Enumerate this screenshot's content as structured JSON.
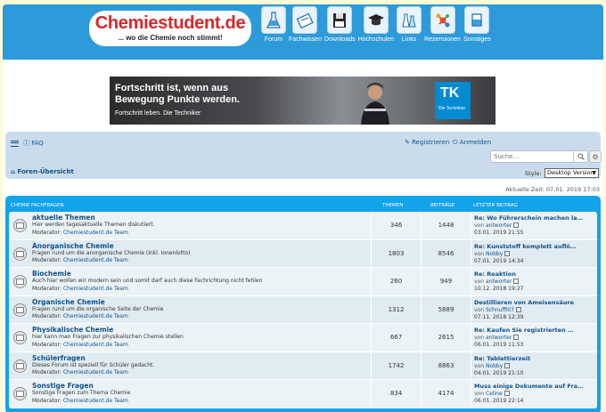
{
  "header": {
    "logo_title": "Chemiestudent.de",
    "logo_subtitle": "... wo die Chemie noch stimmt!",
    "nav": [
      {
        "label": "Forum",
        "icon": "forum-flask-icon"
      },
      {
        "label": "Fachwissen",
        "icon": "fachwissen-book-icon"
      },
      {
        "label": "Downloads",
        "icon": "downloads-disk-icon"
      },
      {
        "label": "Hochschulen",
        "icon": "hochschulen-graduation-cap-icon"
      },
      {
        "label": "Links",
        "icon": "links-bottles-icon"
      },
      {
        "label": "Rezensionen",
        "icon": "rezensionen-molecule-icon"
      },
      {
        "label": "Sonstiges",
        "icon": "sonstiges-beaker-icon"
      }
    ]
  },
  "ad": {
    "headline": "Fortschritt ist, wenn aus Bewegung Punkte werden.",
    "subline": "Fortschritt leben. Die Techniker",
    "brand_logo": "TK",
    "brand_text": "Die Techniker",
    "brand_color": "#008bd2"
  },
  "navbar": {
    "faq": "FAQ",
    "register": "Registrieren",
    "login": "Anmelden",
    "search_placeholder": "Suche…",
    "home": "Foren-Übersicht",
    "style_label": "Style:",
    "style_value": "Desktop Version"
  },
  "current_time": "Aktuelle Zeit: 07.01. 2019 17:03",
  "forum_table": {
    "headers": {
      "category": "Chemie Fachfragen",
      "topics": "Themen",
      "posts": "Beiträge",
      "last_post": "Letzter Beitrag"
    },
    "rows": [
      {
        "title": "aktuelle Themen",
        "desc": "Hier werden tagesaktuelle Themen diskutiert.",
        "mod_label": "Moderator:",
        "mod": "Chemiestudent.de Team",
        "topics": "346",
        "posts": "1448",
        "last_title": "Re: Wo Führerschein machen la…",
        "by_label": "von",
        "last_user": "antworter",
        "last_date": "03.01. 2019 21:55"
      },
      {
        "title": "Anorganische Chemie",
        "desc": "Fragen rund um die anorganische Chemie (inkl. Ionenlotto)",
        "mod_label": "Moderator:",
        "mod": "Chemiestudent.de Team",
        "topics": "1803",
        "posts": "8546",
        "last_title": "Re: Kunststoff komplett auflö…",
        "by_label": "von",
        "last_user": "Nobby",
        "last_date": "07.01. 2019 14:34"
      },
      {
        "title": "Biochemie",
        "desc": "Auch hier wollen wir modern sein und somit darf auch diese Fachrichtung nicht fehlen",
        "mod_label": "Moderator:",
        "mod": "Chemiestudent.de Team",
        "topics": "260",
        "posts": "949",
        "last_title": "Re: Reaktion",
        "by_label": "von",
        "last_user": "antworter",
        "last_date": "10.12. 2018 19:27"
      },
      {
        "title": "Organische Chemie",
        "desc": "Fragen rund um die organische Seite der Chemie",
        "mod_label": "Moderator:",
        "mod": "Chemiestudent.de Team",
        "topics": "1312",
        "posts": "5889",
        "last_title": "Destillieren von Ameisensäure",
        "by_label": "von",
        "last_user": "Schnuffi07",
        "last_date": "07.11. 2018 12:39"
      },
      {
        "title": "Physikalische Chemie",
        "desc": "hier kann man Fragen zur physikalischen Chemie stellen",
        "mod_label": "Moderator:",
        "mod": "Chemiestudent.de Team",
        "topics": "667",
        "posts": "2615",
        "last_title": "Re: Kaufen Sie registrierten …",
        "by_label": "von",
        "last_user": "antworter",
        "last_date": "06.01. 2019 11:53"
      },
      {
        "title": "Schülerfragen",
        "desc": "Dieses Forum ist speziell für Schüler gedacht.",
        "mod_label": "Moderator:",
        "mod": "Chemiestudent.de Team",
        "topics": "1742",
        "posts": "8863",
        "last_title": "Re: Tablettierzeit",
        "by_label": "von",
        "last_user": "Nobby",
        "last_date": "04.01. 2019 21:10"
      },
      {
        "title": "Sonstige Fragen",
        "desc": "Sonstige Fragen zum Thema Chemie",
        "mod_label": "Moderator:",
        "mod": "Chemiestudent.de Team",
        "topics": "834",
        "posts": "4174",
        "last_title": "Muss einige Dokumente auf Fra…",
        "by_label": "von",
        "last_user": "Celine",
        "last_date": "06.01. 2019 22:14"
      }
    ]
  },
  "colors": {
    "header_bg": "#2d9ad9",
    "logo_red": "#d6282c",
    "page_bg": "#fdfbd3",
    "table_header": "#12a3eb",
    "link": "#105289"
  }
}
